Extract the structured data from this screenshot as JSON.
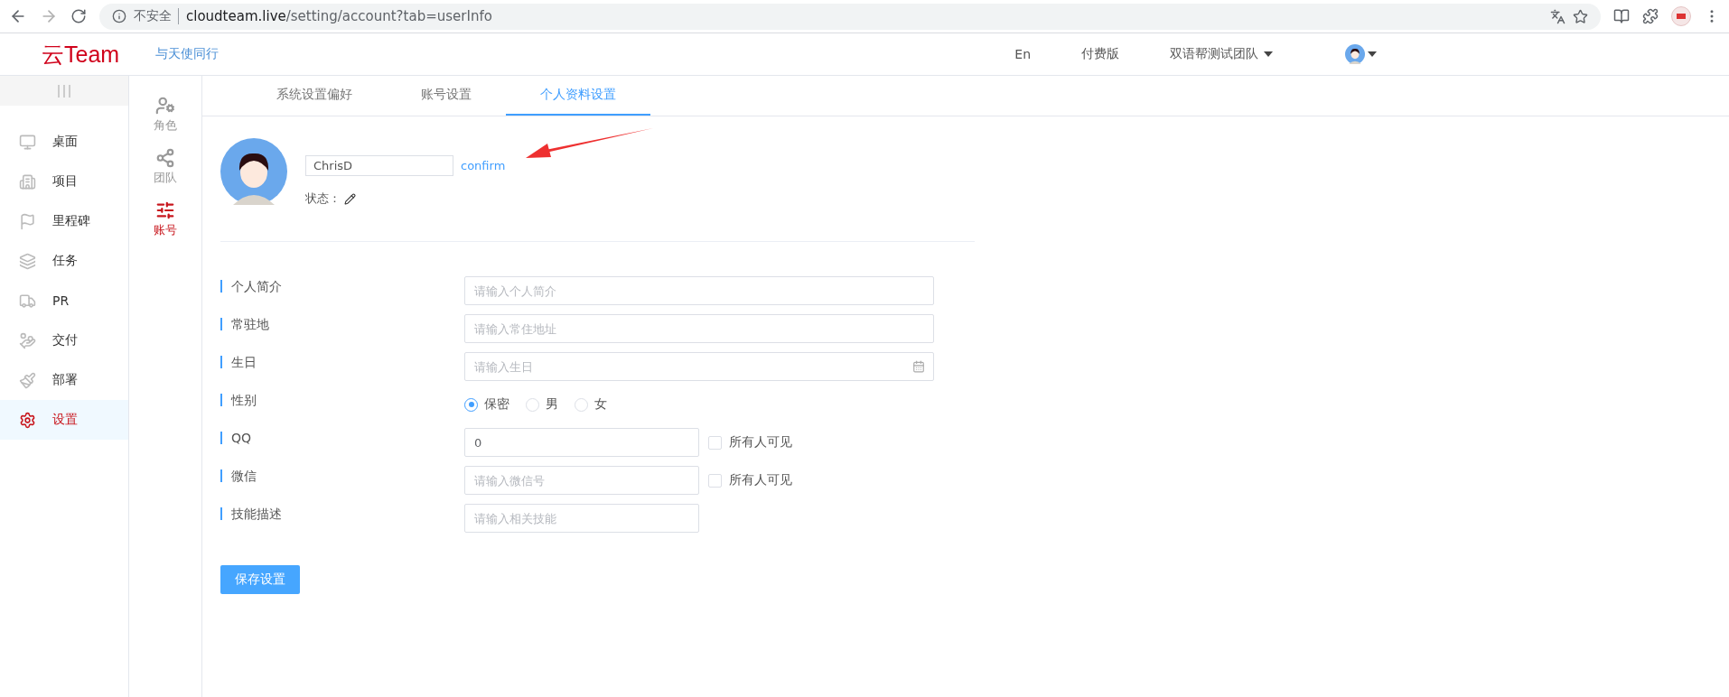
{
  "browser": {
    "security_label": "不安全",
    "url_host": "cloudteam.live",
    "url_path": "/setting/account?tab=userInfo"
  },
  "header": {
    "logo": "云Team",
    "slogan": "与天使同行",
    "links": [
      "En",
      "付费版"
    ],
    "team": "双语帮测试团队"
  },
  "sidebar": {
    "items": [
      {
        "label": "桌面",
        "selected": false
      },
      {
        "label": "项目",
        "selected": false
      },
      {
        "label": "里程碑",
        "selected": false
      },
      {
        "label": "任务",
        "selected": false
      },
      {
        "label": "PR",
        "selected": false
      },
      {
        "label": "交付",
        "selected": false
      },
      {
        "label": "部署",
        "selected": false
      },
      {
        "label": "设置",
        "selected": true
      }
    ]
  },
  "subnav": {
    "items": [
      {
        "label": "角色",
        "selected": false
      },
      {
        "label": "团队",
        "selected": false
      },
      {
        "label": "账号",
        "selected": true
      }
    ]
  },
  "tabs": [
    {
      "label": "系统设置偏好",
      "selected": false
    },
    {
      "label": "账号设置",
      "selected": false
    },
    {
      "label": "个人资料设置",
      "selected": true
    }
  ],
  "profile": {
    "name_value": "ChrisD",
    "confirm": "confirm",
    "status_label": "状态："
  },
  "form": {
    "rows": [
      {
        "kind": "wide",
        "label": "个人简介",
        "placeholder": "请输入个人简介"
      },
      {
        "kind": "wide",
        "label": "常驻地",
        "placeholder": "请输入常住地址"
      },
      {
        "kind": "date",
        "label": "生日",
        "placeholder": "请输入生日"
      },
      {
        "kind": "radio",
        "label": "性别",
        "options": [
          {
            "label": "保密",
            "selected": true
          },
          {
            "label": "男",
            "selected": false
          },
          {
            "label": "女",
            "selected": false
          }
        ]
      },
      {
        "kind": "short",
        "label": "QQ",
        "value": "0",
        "checkbox": {
          "label": "所有人可见",
          "checked": false
        }
      },
      {
        "kind": "short",
        "label": "微信",
        "placeholder": "请输入微信号",
        "checkbox": {
          "label": "所有人可见",
          "checked": false
        }
      },
      {
        "kind": "short",
        "label": "技能描述",
        "placeholder": "请输入相关技能"
      }
    ],
    "save": "保存设置"
  }
}
